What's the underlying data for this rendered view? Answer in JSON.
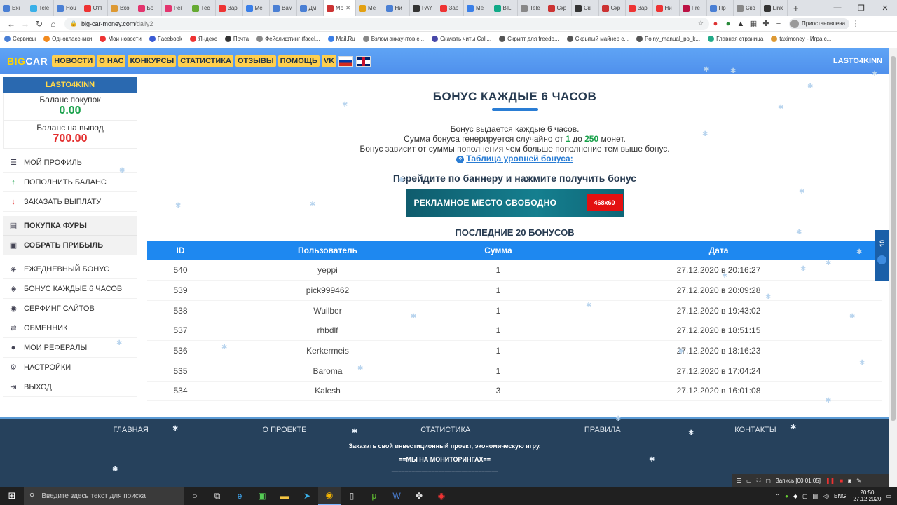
{
  "browser": {
    "tabs": [
      "Exi",
      "Tele",
      "Hou",
      "Отт",
      "Вхо",
      "Бо",
      "Рег",
      "Тес",
      "Зар",
      "Ме",
      "Вам",
      "Дм",
      "Мо",
      "Ме",
      "Ни",
      "PAY",
      "Зар",
      "Ме",
      "BIL",
      "Tele",
      "Скр",
      "Скі",
      "Скр",
      "Зар",
      "Ни",
      "Fre",
      "Пр",
      "Ско",
      "Link"
    ],
    "active_tab": "Мо",
    "url_host": "big-car-money.com",
    "url_path": "/daily2",
    "profile_label": "Приостановлена",
    "bookmarks": [
      "Сервисы",
      "Одноклассники",
      "Мои новости",
      "Facebook",
      "Яндекс",
      "Почта",
      "Фейслифтинг (facel...",
      "Mail.Ru",
      "Взлом аккаунтов с...",
      "Скачать читы Call...",
      "Скрипт для freedo...",
      "Скрытый майнер с...",
      "Polny_manual_po_k...",
      "Главная страница",
      "taximoney - Игра с..."
    ]
  },
  "header": {
    "logo_a": "BIG",
    "logo_b": "CAR",
    "nav": [
      "НОВОСТИ",
      "О НАС",
      "КОНКУРСЫ",
      "СТАТИСТИКА",
      "ОТЗЫВЫ",
      "ПОМОЩЬ",
      "VK"
    ],
    "username": "LASTO4KINN"
  },
  "sidebar": {
    "username": "LASTO4KINN",
    "purchase_label": "Баланс покупок",
    "purchase_value": "0.00",
    "withdraw_label": "Баланс на вывод",
    "withdraw_value": "700.00",
    "menu1": [
      {
        "icon": "menu-icon",
        "glyph": "☰",
        "label": "МОЙ ПРОФИЛЬ"
      },
      {
        "icon": "arrow-up-icon",
        "glyph": "↑",
        "label": "ПОПОЛНИТЬ БАЛАНС"
      },
      {
        "icon": "arrow-down-icon",
        "glyph": "↓",
        "label": "ЗАКАЗАТЬ ВЫПЛАТУ"
      }
    ],
    "menu2": [
      {
        "icon": "truck-icon",
        "glyph": "▤",
        "label": "ПОКУПКА ФУРЫ"
      },
      {
        "icon": "money-icon",
        "glyph": "▣",
        "label": "СОБРАТЬ ПРИБЫЛЬ"
      }
    ],
    "menu3": [
      {
        "icon": "gift-icon",
        "glyph": "◈",
        "label": "ЕЖЕДНЕВНЫЙ БОНУС"
      },
      {
        "icon": "gift-icon",
        "glyph": "◈",
        "label": "БОНУС КАЖДЫЕ 6 ЧАСОВ"
      },
      {
        "icon": "eye-icon",
        "glyph": "◉",
        "label": "СЕРФИНГ САЙТОВ"
      },
      {
        "icon": "exchange-icon",
        "glyph": "⇄",
        "label": "ОБМЕННИК"
      },
      {
        "icon": "users-icon",
        "glyph": "●",
        "label": "МОИ РЕФЕРАЛЫ"
      },
      {
        "icon": "gear-icon",
        "glyph": "⚙",
        "label": "НАСТРОЙКИ"
      },
      {
        "icon": "logout-icon",
        "glyph": "⇥",
        "label": "ВЫХОД"
      }
    ]
  },
  "main": {
    "title": "БОНУС КАЖДЫЕ 6 ЧАСОВ",
    "line1": "Бонус выдается каждые 6 часов.",
    "line2_pre": "Сумма бонуса генерируется случайно от ",
    "line2_min": "1",
    "line2_mid": " до ",
    "line2_max": "250",
    "line2_post": " монет.",
    "line3": "Бонус зависит от суммы пополнения чем больше пополнение тем выше бонус.",
    "levels_link": "Таблица уровней бонуса:",
    "banner_cta": "Перейдите по баннеру и нажмите получить бонус",
    "ad_text": "РЕКЛАМНОЕ МЕСТО СВОБОДНО",
    "ad_size": "468x60",
    "last_title": "ПОСЛЕДНИЕ 20 БОНУСОВ",
    "columns": [
      "ID",
      "Пользователь",
      "Сумма",
      "Дата"
    ],
    "rows": [
      [
        "540",
        "yeppi",
        "1",
        "27.12.2020 в 20:16:27"
      ],
      [
        "539",
        "pick999462",
        "1",
        "27.12.2020 в 20:09:28"
      ],
      [
        "538",
        "Wuilber",
        "1",
        "27.12.2020 в 19:43:02"
      ],
      [
        "537",
        "rhbdlf",
        "1",
        "27.12.2020 в 18:51:15"
      ],
      [
        "536",
        "Kerkermeis",
        "1",
        "27.12.2020 в 18:16:23"
      ],
      [
        "535",
        "Baroma",
        "1",
        "27.12.2020 в 17:04:24"
      ],
      [
        "534",
        "Kalesh",
        "3",
        "27.12.2020 в 16:01:08"
      ]
    ]
  },
  "footer": {
    "nav": [
      "ГЛАВНАЯ",
      "О ПРОЕКТЕ",
      "СТАТИСТИКА",
      "ПРАВИЛА",
      "КОНТАКТЫ"
    ],
    "line1": "Заказать свой инвестиционный проект, экономическую игру.",
    "line2": "==МЫ НА МОНИТОРИНГАХ==",
    "line3": "================================"
  },
  "side_widget": "10",
  "recorder": {
    "label": "Запись [00:01:05]"
  },
  "taskbar": {
    "search_placeholder": "Введите здесь текст для поиска",
    "lang": "ENG",
    "time": "20:50",
    "date": "27.12.2020"
  },
  "colors": {
    "accent": "#1e88f0",
    "header": "#5fa4f5",
    "footer": "#26415c",
    "green": "#18a14a",
    "red": "#e32d2d"
  }
}
